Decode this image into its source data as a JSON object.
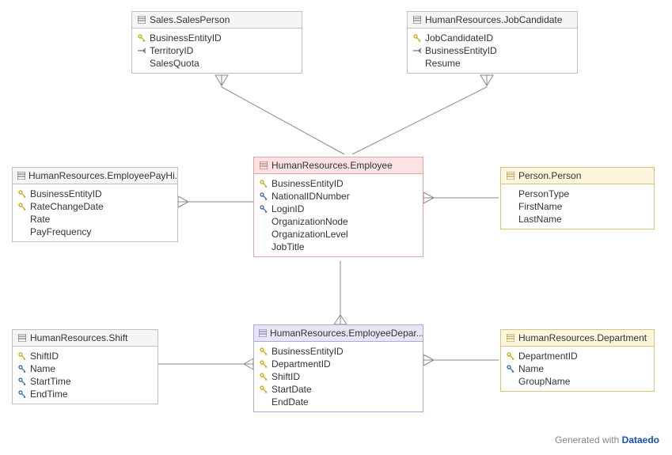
{
  "footer": {
    "prefix": "Generated with ",
    "brand": "Dataedo"
  },
  "entities": {
    "salesPerson": {
      "title": "Sales.SalesPerson",
      "cols": [
        {
          "icon": "pk",
          "name": "BusinessEntityID"
        },
        {
          "icon": "fk",
          "name": "TerritoryID"
        },
        {
          "icon": "none",
          "name": "SalesQuota"
        }
      ]
    },
    "jobCandidate": {
      "title": "HumanResources.JobCandidate",
      "cols": [
        {
          "icon": "pk",
          "name": "JobCandidateID"
        },
        {
          "icon": "fk",
          "name": "BusinessEntityID"
        },
        {
          "icon": "none",
          "name": "Resume"
        }
      ]
    },
    "employeePayHistory": {
      "title": "HumanResources.EmployeePayHi...",
      "cols": [
        {
          "icon": "pk",
          "name": "BusinessEntityID"
        },
        {
          "icon": "pk",
          "name": "RateChangeDate"
        },
        {
          "icon": "none",
          "name": "Rate"
        },
        {
          "icon": "none",
          "name": "PayFrequency"
        }
      ]
    },
    "employee": {
      "title": "HumanResources.Employee",
      "cols": [
        {
          "icon": "pk",
          "name": "BusinessEntityID"
        },
        {
          "icon": "uk",
          "name": "NationalIDNumber"
        },
        {
          "icon": "uk",
          "name": "LoginID"
        },
        {
          "icon": "none",
          "name": "OrganizationNode"
        },
        {
          "icon": "none",
          "name": "OrganizationLevel"
        },
        {
          "icon": "none",
          "name": "JobTitle"
        }
      ]
    },
    "person": {
      "title": "Person.Person",
      "cols": [
        {
          "icon": "none",
          "name": "PersonType"
        },
        {
          "icon": "none",
          "name": "FirstName"
        },
        {
          "icon": "none",
          "name": "LastName"
        }
      ]
    },
    "shift": {
      "title": "HumanResources.Shift",
      "cols": [
        {
          "icon": "pk",
          "name": "ShiftID"
        },
        {
          "icon": "uk",
          "name": "Name"
        },
        {
          "icon": "uk",
          "name": "StartTime"
        },
        {
          "icon": "uk",
          "name": "EndTime"
        }
      ]
    },
    "employeeDeptHistory": {
      "title": "HumanResources.EmployeeDepar...",
      "cols": [
        {
          "icon": "pk",
          "name": "BusinessEntityID"
        },
        {
          "icon": "pk",
          "name": "DepartmentID"
        },
        {
          "icon": "pk",
          "name": "ShiftID"
        },
        {
          "icon": "pk",
          "name": "StartDate"
        },
        {
          "icon": "none",
          "name": "EndDate"
        }
      ]
    },
    "department": {
      "title": "HumanResources.Department",
      "cols": [
        {
          "icon": "pk",
          "name": "DepartmentID"
        },
        {
          "icon": "uk",
          "name": "Name"
        },
        {
          "icon": "none",
          "name": "GroupName"
        }
      ]
    }
  },
  "chart_data": {
    "type": "er-diagram",
    "entities": [
      {
        "name": "Sales.SalesPerson",
        "columns": [
          "BusinessEntityID (PK)",
          "TerritoryID (FK)",
          "SalesQuota"
        ]
      },
      {
        "name": "HumanResources.JobCandidate",
        "columns": [
          "JobCandidateID (PK)",
          "BusinessEntityID (FK)",
          "Resume"
        ]
      },
      {
        "name": "HumanResources.EmployeePayHistory",
        "columns": [
          "BusinessEntityID (PK)",
          "RateChangeDate (PK)",
          "Rate",
          "PayFrequency"
        ]
      },
      {
        "name": "HumanResources.Employee",
        "columns": [
          "BusinessEntityID (PK)",
          "NationalIDNumber (UK)",
          "LoginID (UK)",
          "OrganizationNode",
          "OrganizationLevel",
          "JobTitle"
        ]
      },
      {
        "name": "Person.Person",
        "columns": [
          "PersonType",
          "FirstName",
          "LastName"
        ]
      },
      {
        "name": "HumanResources.Shift",
        "columns": [
          "ShiftID (PK)",
          "Name (UK)",
          "StartTime (UK)",
          "EndTime (UK)"
        ]
      },
      {
        "name": "HumanResources.EmployeeDepartmentHistory",
        "columns": [
          "BusinessEntityID (PK)",
          "DepartmentID (PK)",
          "ShiftID (PK)",
          "StartDate (PK)",
          "EndDate"
        ]
      },
      {
        "name": "HumanResources.Department",
        "columns": [
          "DepartmentID (PK)",
          "Name (UK)",
          "GroupName"
        ]
      }
    ],
    "relationships": [
      {
        "from": "Sales.SalesPerson",
        "to": "HumanResources.Employee",
        "type": "many-to-one"
      },
      {
        "from": "HumanResources.JobCandidate",
        "to": "HumanResources.Employee",
        "type": "many-to-one"
      },
      {
        "from": "HumanResources.EmployeePayHistory",
        "to": "HumanResources.Employee",
        "type": "many-to-one"
      },
      {
        "from": "HumanResources.Employee",
        "to": "Person.Person",
        "type": "many-to-one"
      },
      {
        "from": "HumanResources.EmployeeDepartmentHistory",
        "to": "HumanResources.Employee",
        "type": "many-to-one"
      },
      {
        "from": "HumanResources.EmployeeDepartmentHistory",
        "to": "HumanResources.Shift",
        "type": "many-to-one"
      },
      {
        "from": "HumanResources.EmployeeDepartmentHistory",
        "to": "HumanResources.Department",
        "type": "many-to-one"
      }
    ]
  }
}
